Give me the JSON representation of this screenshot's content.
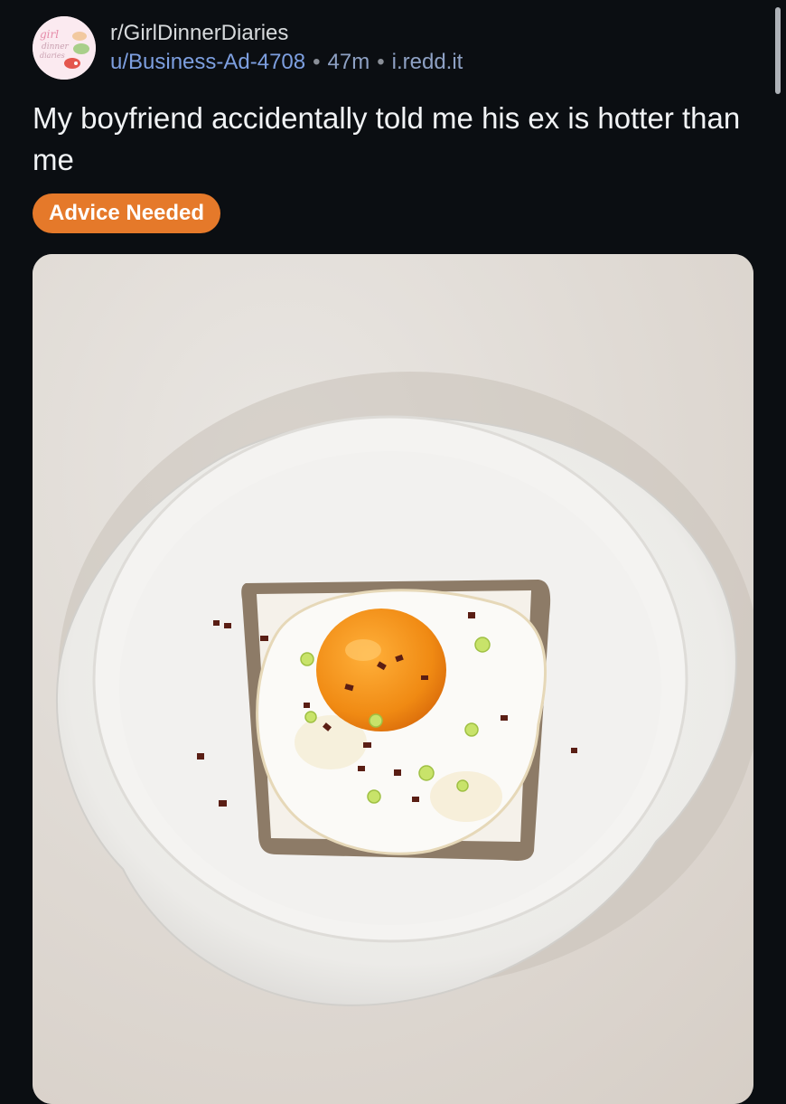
{
  "post": {
    "subreddit": "r/GirlDinnerDiaries",
    "author": "u/Business-Ad-4708",
    "separator": "•",
    "age": "47m",
    "domain": "i.redd.it",
    "title": "My boyfriend accidentally told me his ex is hotter than me",
    "flair": "Advice Needed"
  },
  "subreddit_icon": {
    "text_line1": "girl",
    "text_line2": "dinner",
    "text_line3": "diaries"
  },
  "colors": {
    "background": "#0b0e12",
    "flair_bg": "#e5792a",
    "author_link": "#7d9fe0"
  },
  "image": {
    "subject": "fried egg on toast in white plate",
    "icon": "photo-icon"
  }
}
